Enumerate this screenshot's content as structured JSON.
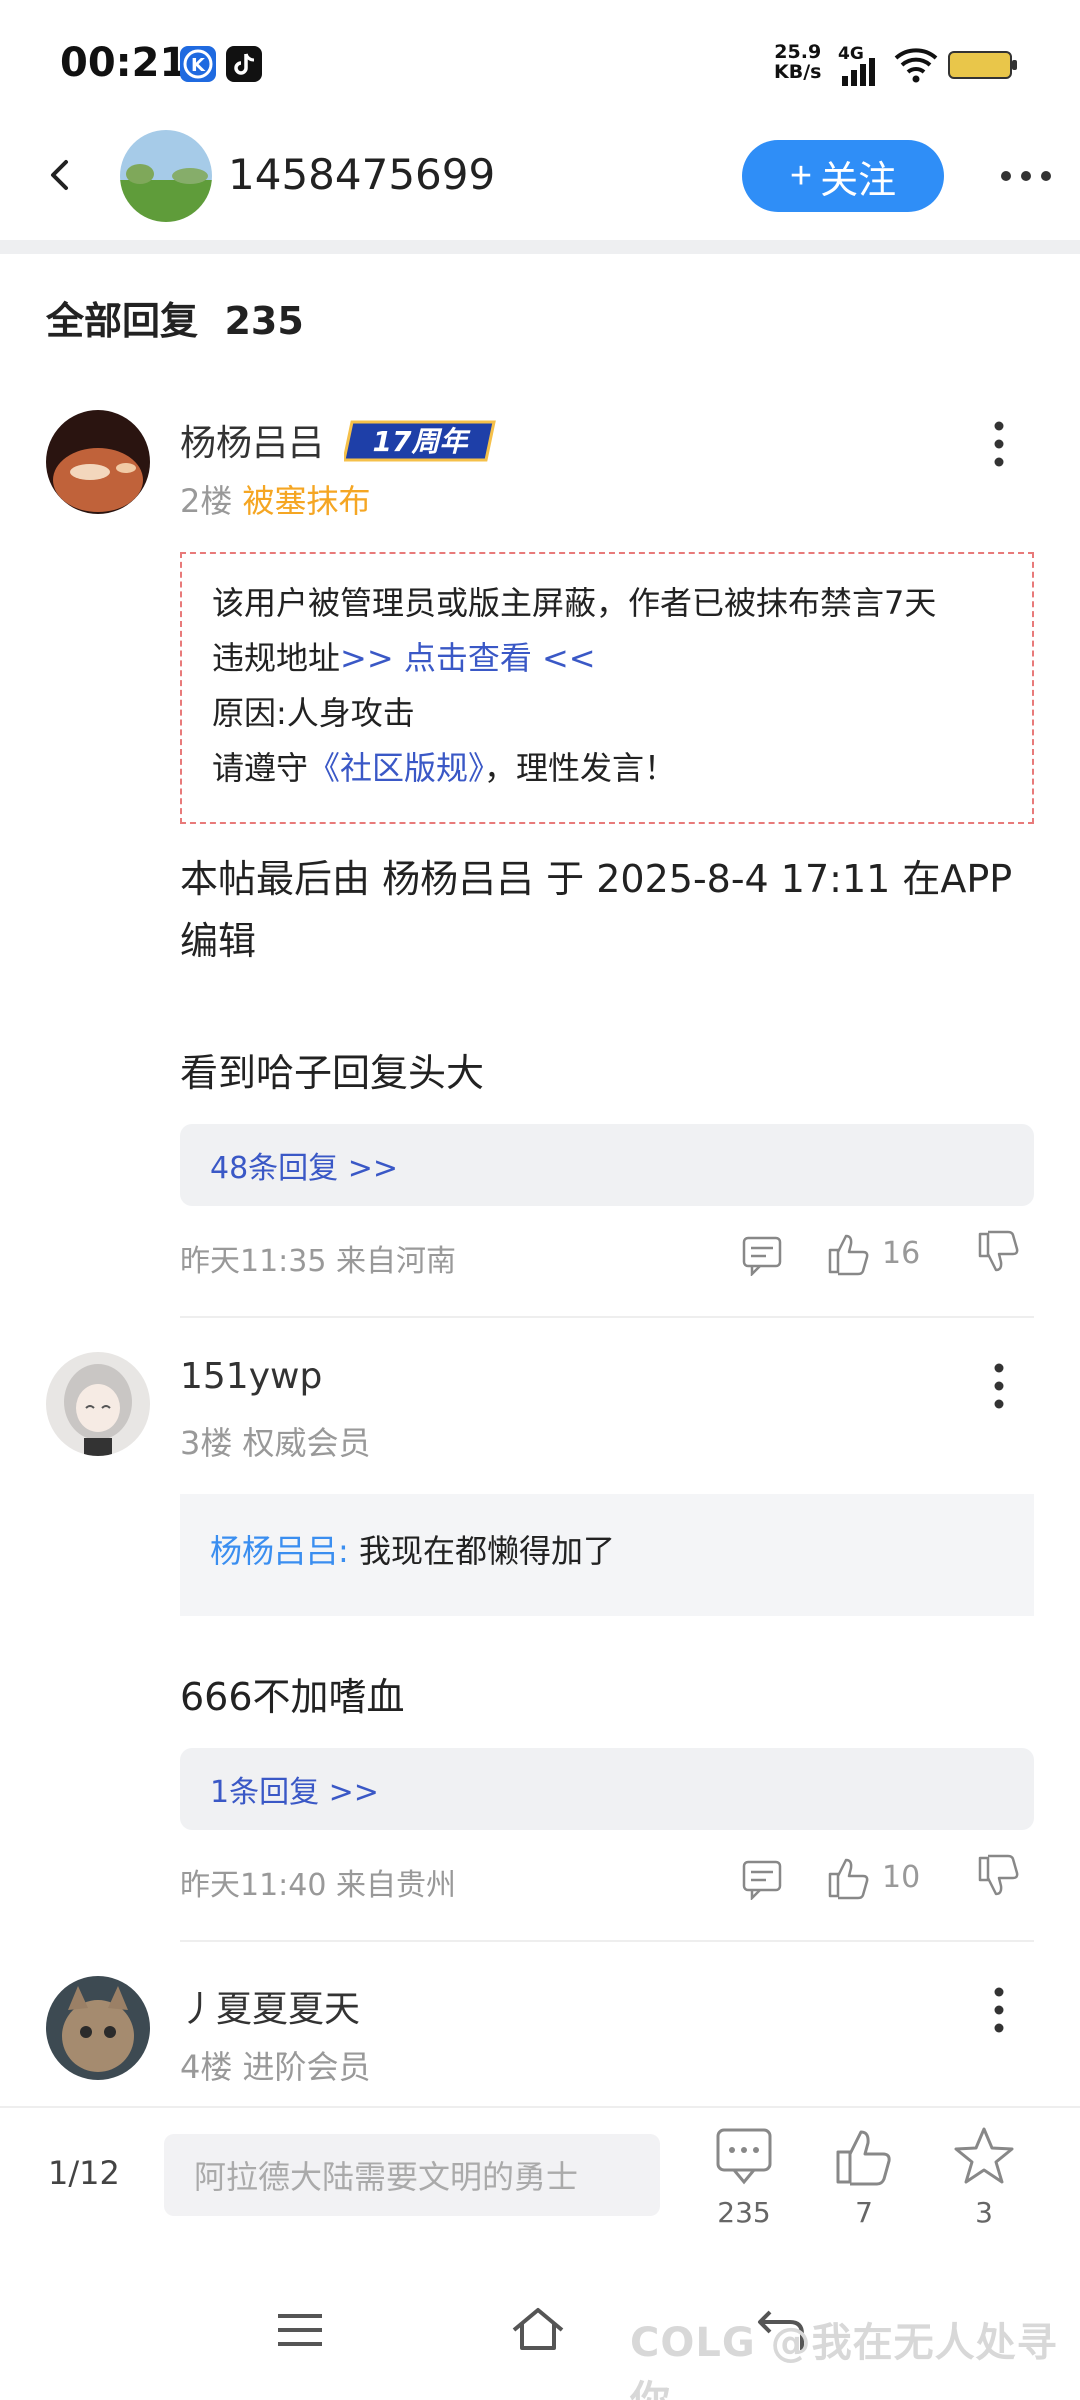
{
  "status_bar": {
    "time": "00:21",
    "speed_value": "25.9",
    "speed_unit": "KB/s",
    "network": "4G",
    "icons": [
      "app-k-icon",
      "tiktok-icon",
      "signal-icon",
      "wifi-icon",
      "battery-icon"
    ]
  },
  "header": {
    "username": "1458475699",
    "follow_label": "关注",
    "follow_prefix": "+"
  },
  "replies_header": {
    "label": "全部回复",
    "count": "235"
  },
  "posts": [
    {
      "name": "杨杨吕吕",
      "badge": "17周年",
      "floor": "2楼",
      "status": "被塞抹布",
      "notice": {
        "line1": "该用户被管理员或版主屏蔽，作者已被抹布禁言7天",
        "line2_prefix": "违规地址",
        "line2_link": ">> 点击查看 <<",
        "line3": "原因:人身攻击",
        "line4_prefix": "请遵守",
        "line4_link": "《社区版规》",
        "line4_suffix": "，理性发言！"
      },
      "edit_note": "本帖最后由 杨杨吕吕 于 2025-8-4 17:11 在APP编辑",
      "content": "看到哈子回复头大",
      "replies_link": "48条回复 >>",
      "meta": "昨天11:35 来自河南",
      "likes": "16"
    },
    {
      "name": "151ywp",
      "floor": "3楼",
      "status": "权威会员",
      "quote_name": "杨杨吕吕:",
      "quote_text": "我现在都懒得加了",
      "content": "666不加嗜血",
      "replies_link": "1条回复 >>",
      "meta": "昨天11:40 来自贵州",
      "likes": "10"
    },
    {
      "name": "丿夏夏夏天",
      "floor": "4楼",
      "status": "进阶会员"
    }
  ],
  "bottom_bar": {
    "page": "1/12",
    "input_placeholder": "阿拉德大陆需要文明的勇士",
    "comments": "235",
    "likes": "7",
    "stars": "3"
  },
  "watermark": "COLG @我在无人处寻你",
  "colors": {
    "accent": "#2f8ef7",
    "link": "#3a58c6",
    "status_orange": "#f5a623",
    "notice_border": "#e87a7a"
  }
}
